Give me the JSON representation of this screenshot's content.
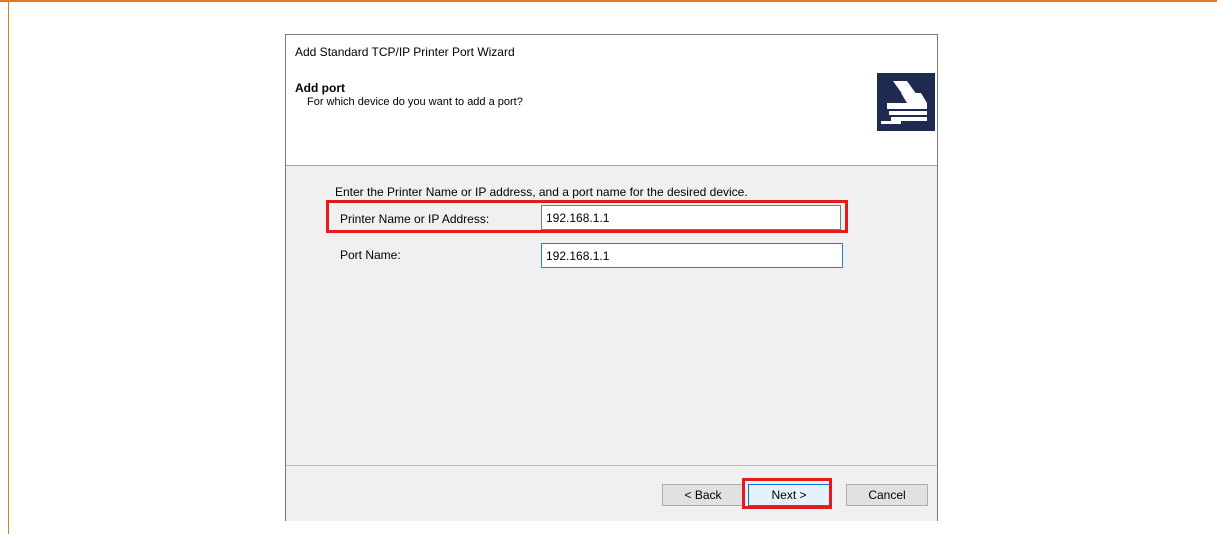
{
  "window": {
    "title": "Add Standard TCP/IP Printer Port Wizard"
  },
  "header": {
    "title": "Add port",
    "subtitle": "For which device do you want to add a port?",
    "icon": "printer-icon"
  },
  "main": {
    "instructions": "Enter the Printer Name or IP address, and a port name for the desired device.",
    "fields": [
      {
        "label": "Printer Name or IP Address:",
        "value": "192.168.1.1",
        "highlighted": true
      },
      {
        "label": "Port Name:",
        "value": "192.168.1.1",
        "highlighted": false
      }
    ]
  },
  "footer": {
    "back_label": "< Back",
    "next_label": "Next >",
    "cancel_label": "Cancel"
  },
  "colors": {
    "highlight": "#e21c1c",
    "frame_accent": "#e07b24",
    "icon_background": "#1f2a50",
    "focus_border": "#2a7ad6"
  }
}
